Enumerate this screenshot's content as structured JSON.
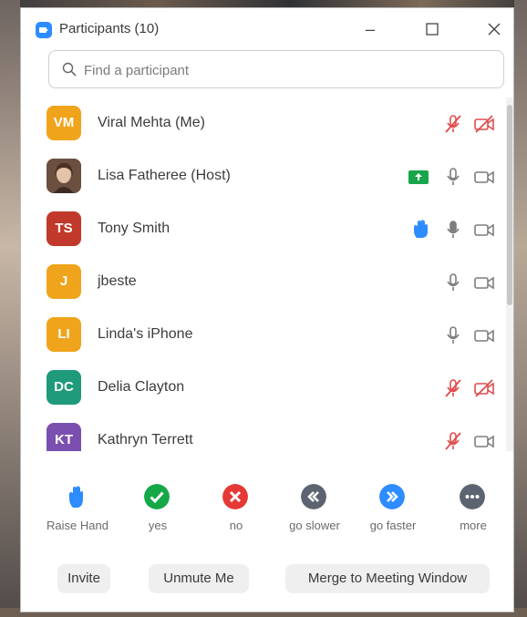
{
  "window": {
    "title": "Participants (10)"
  },
  "search": {
    "placeholder": "Find a participant"
  },
  "participants": [
    {
      "initials": "VM",
      "name": "Viral Mehta (Me)",
      "avatar_color": "#f0a41c",
      "mic": "muted",
      "video": "off",
      "raised_hand": false,
      "share": false
    },
    {
      "initials": "",
      "name": "Lisa Fatheree (Host)",
      "avatar_color": "#7a5a48",
      "mic": "on",
      "video": "on",
      "raised_hand": false,
      "share": true
    },
    {
      "initials": "TS",
      "name": "Tony Smith",
      "avatar_color": "#c0392b",
      "mic": "on",
      "video": "on",
      "raised_hand": true,
      "share": false
    },
    {
      "initials": "J",
      "name": "jbeste",
      "avatar_color": "#f0a41c",
      "mic": "on",
      "video": "on",
      "raised_hand": false,
      "share": false
    },
    {
      "initials": "LI",
      "name": "Linda's iPhone",
      "avatar_color": "#f0a41c",
      "mic": "on",
      "video": "on",
      "raised_hand": false,
      "share": false
    },
    {
      "initials": "DC",
      "name": "Delia Clayton",
      "avatar_color": "#1f9a7a",
      "mic": "muted",
      "video": "off",
      "raised_hand": false,
      "share": false
    },
    {
      "initials": "KT",
      "name": "Kathryn Terrett",
      "avatar_color": "#7b4fb0",
      "mic": "muted",
      "video": "on",
      "raised_hand": false,
      "share": false
    }
  ],
  "reactions": [
    {
      "label": "Raise Hand",
      "icon": "raise-hand-icon",
      "color": "#2d8cff"
    },
    {
      "label": "yes",
      "icon": "check-icon",
      "color": "#14a846"
    },
    {
      "label": "no",
      "icon": "x-icon",
      "color": "#e53935"
    },
    {
      "label": "go slower",
      "icon": "rewind-icon",
      "color": "#5b6470"
    },
    {
      "label": "go faster",
      "icon": "fast-forward-icon",
      "color": "#2d8cff"
    },
    {
      "label": "more",
      "icon": "more-icon",
      "color": "#5b6470"
    }
  ],
  "actions": {
    "invite": "Invite",
    "unmute": "Unmute Me",
    "merge": "Merge to Meeting Window"
  },
  "colors": {
    "muted": "#e04b4b",
    "icon_gray": "#7d7d7d",
    "share_green": "#19a54a",
    "accent": "#2d8cff"
  }
}
